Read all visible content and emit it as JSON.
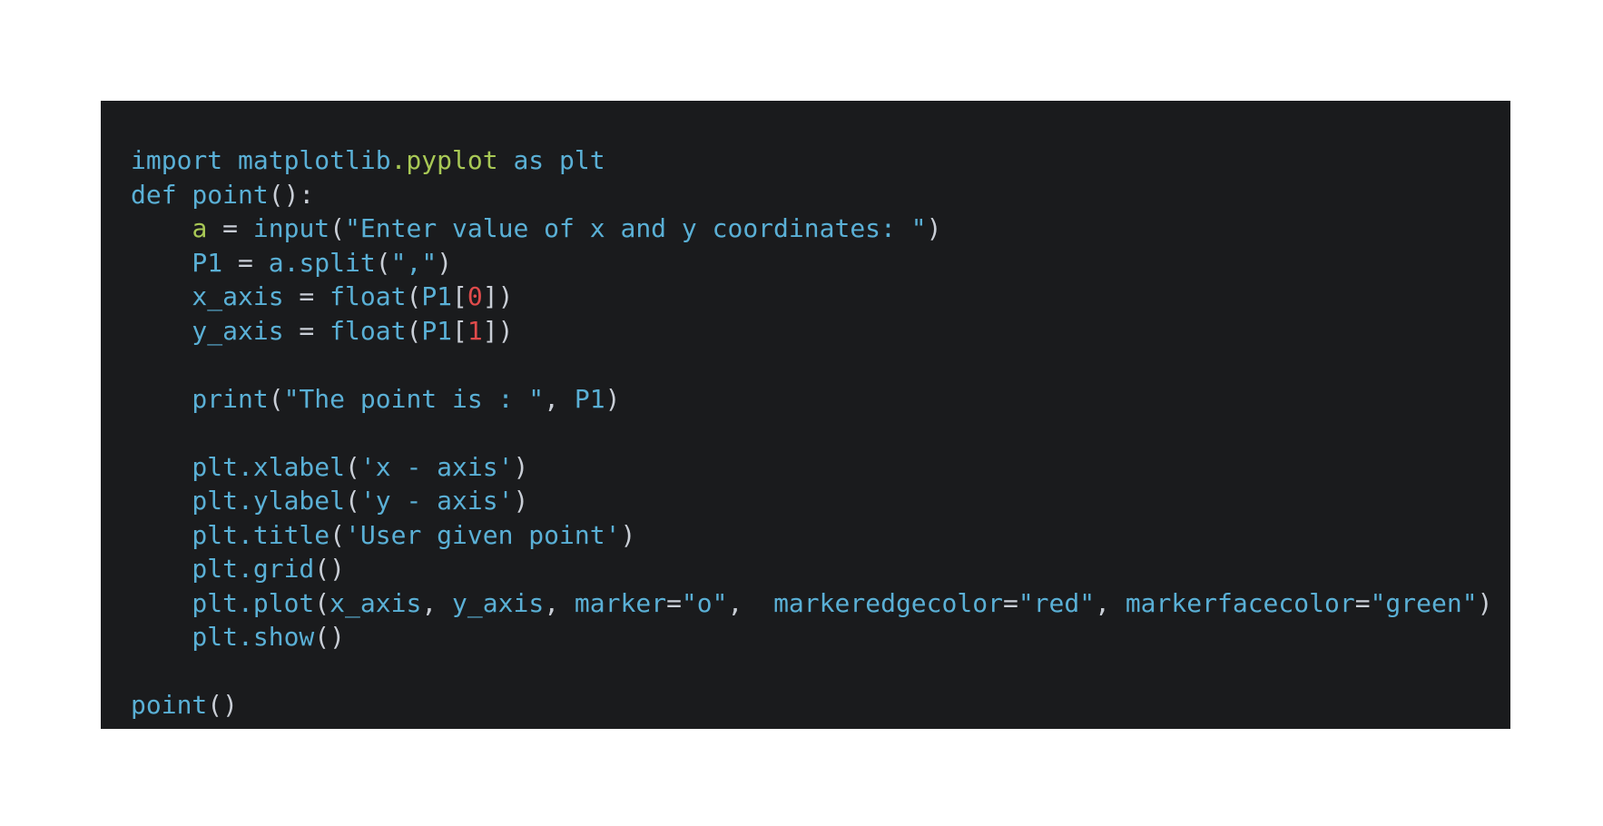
{
  "colors": {
    "background": "#1a1b1d",
    "default": "#5ab0d6",
    "punct": "#c9ced6",
    "attr": "#a8c855",
    "number": "#e04b4b",
    "page": "#ffffff"
  },
  "code_lines": [
    [
      [
        "import matplotlib",
        "default"
      ],
      [
        ".pyplot",
        "attr"
      ],
      [
        " as plt",
        "default"
      ]
    ],
    [
      [
        "def point",
        "default"
      ],
      [
        "():",
        "punct"
      ]
    ],
    [
      [
        "    ",
        "default"
      ],
      [
        "a",
        "attr"
      ],
      [
        " = ",
        "punct"
      ],
      [
        "input",
        "default"
      ],
      [
        "(",
        "punct"
      ],
      [
        "\"Enter value of x and y coordinates: \"",
        "default"
      ],
      [
        ")",
        "punct"
      ]
    ],
    [
      [
        "    P1",
        "default"
      ],
      [
        " = ",
        "punct"
      ],
      [
        "a.split",
        "default"
      ],
      [
        "(",
        "punct"
      ],
      [
        "\",\"",
        "default"
      ],
      [
        ")",
        "punct"
      ]
    ],
    [
      [
        "    x_axis",
        "default"
      ],
      [
        " = ",
        "punct"
      ],
      [
        "float",
        "default"
      ],
      [
        "(",
        "punct"
      ],
      [
        "P1",
        "default"
      ],
      [
        "[",
        "punct"
      ],
      [
        "0",
        "number"
      ],
      [
        "])",
        "punct"
      ]
    ],
    [
      [
        "    y_axis",
        "default"
      ],
      [
        " = ",
        "punct"
      ],
      [
        "float",
        "default"
      ],
      [
        "(",
        "punct"
      ],
      [
        "P1",
        "default"
      ],
      [
        "[",
        "punct"
      ],
      [
        "1",
        "number"
      ],
      [
        "])",
        "punct"
      ]
    ],
    [],
    [
      [
        "    print",
        "default"
      ],
      [
        "(",
        "punct"
      ],
      [
        "\"The point is : \"",
        "default"
      ],
      [
        ", ",
        "punct"
      ],
      [
        "P1",
        "default"
      ],
      [
        ")",
        "punct"
      ]
    ],
    [],
    [
      [
        "    plt.xlabel",
        "default"
      ],
      [
        "(",
        "punct"
      ],
      [
        "'x - axis'",
        "default"
      ],
      [
        ")",
        "punct"
      ]
    ],
    [
      [
        "    plt.ylabel",
        "default"
      ],
      [
        "(",
        "punct"
      ],
      [
        "'y - axis'",
        "default"
      ],
      [
        ")",
        "punct"
      ]
    ],
    [
      [
        "    plt.title",
        "default"
      ],
      [
        "(",
        "punct"
      ],
      [
        "'User given point'",
        "default"
      ],
      [
        ")",
        "punct"
      ]
    ],
    [
      [
        "    plt.grid",
        "default"
      ],
      [
        "()",
        "punct"
      ]
    ],
    [
      [
        "    plt.plot",
        "default"
      ],
      [
        "(",
        "punct"
      ],
      [
        "x_axis",
        "default"
      ],
      [
        ", ",
        "punct"
      ],
      [
        "y_axis",
        "default"
      ],
      [
        ", ",
        "punct"
      ],
      [
        "marker",
        "default"
      ],
      [
        "=",
        "punct"
      ],
      [
        "\"o\"",
        "default"
      ],
      [
        ",  ",
        "punct"
      ],
      [
        "markeredgecolor",
        "default"
      ],
      [
        "=",
        "punct"
      ],
      [
        "\"red\"",
        "default"
      ],
      [
        ", ",
        "punct"
      ],
      [
        "markerfacecolor",
        "default"
      ],
      [
        "=",
        "punct"
      ],
      [
        "\"green\"",
        "default"
      ],
      [
        ")",
        "punct"
      ]
    ],
    [
      [
        "    plt.show",
        "default"
      ],
      [
        "()",
        "punct"
      ]
    ],
    [],
    [
      [
        "point",
        "default"
      ],
      [
        "()",
        "punct"
      ]
    ]
  ]
}
